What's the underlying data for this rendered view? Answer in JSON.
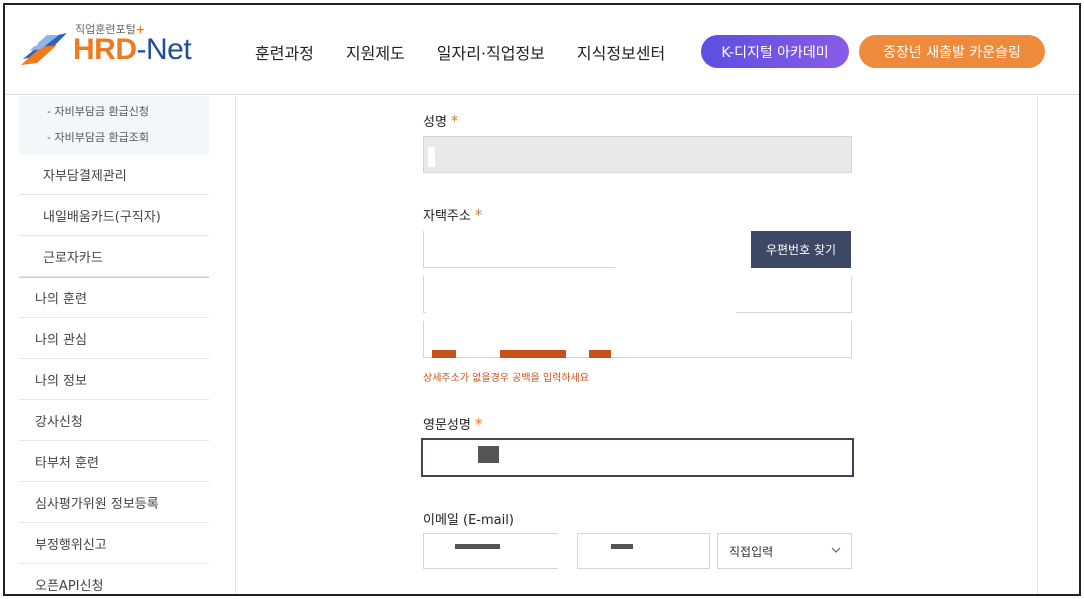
{
  "header": {
    "logo_tagline": "직업훈련포털",
    "logo_plus": "+",
    "logo_hrd": "HRD",
    "logo_dash": "-",
    "logo_net": "Net",
    "nav": [
      "훈련과정",
      "지원제도",
      "일자리·직업정보",
      "지식정보센터"
    ],
    "btn_kdigital": "K-디지털 아카데미",
    "btn_counsel": "중장년 새출발 카운슬링",
    "colors": {
      "kdigital": "#6a52e4",
      "counsel": "#ee8a3c",
      "brand_orange": "#f07a1f",
      "brand_blue": "#1f4e9c"
    }
  },
  "sidebar": {
    "sub_items": [
      "- 자비부담금 환급신청",
      "- 자비부담금 환급조회"
    ],
    "second_level": [
      "자부담결제관리",
      "내일배움카드(구직자)",
      "근로자카드"
    ],
    "top_level": [
      "나의 훈련",
      "나의 관심",
      "나의 정보",
      "강사신청",
      "타부처 훈련",
      "심사평가위원 정보등록",
      "부정행위신고",
      "오픈API신청"
    ]
  },
  "form": {
    "name_label": "성명",
    "address_label": "자택주소",
    "postal_button": "우편번호 찾기",
    "address_hint": "상세주소가 없을경우 공백을 입력하세요",
    "english_name_label": "영문성명",
    "email_label": "이메일 (E-mail)",
    "email_domain_select": "직접입력",
    "required_mark": "*",
    "colors": {
      "required": "#e47b1c",
      "hint": "#c8501a",
      "postal_button": "#3d4866"
    }
  }
}
